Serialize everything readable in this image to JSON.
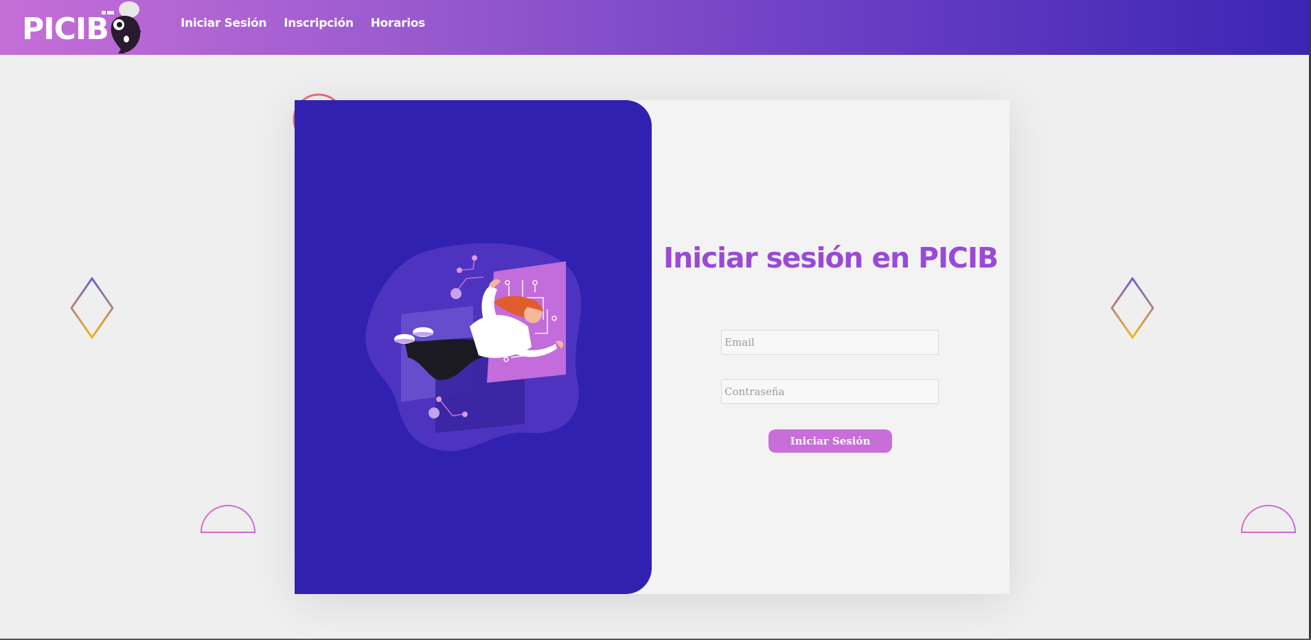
{
  "brand": {
    "logo_text": "PICIB",
    "colors": {
      "nav_start": "#c56ed8",
      "nav_end": "#3b25b3",
      "card_panel": "#3021b0",
      "accent": "#9a4ad6",
      "button": "#c76ed9"
    }
  },
  "nav": {
    "links": [
      {
        "label": "Iniciar Sesión"
      },
      {
        "label": "Inscripción"
      },
      {
        "label": "Horarios"
      }
    ]
  },
  "login": {
    "title": "Iniciar sesión en PICIB",
    "email": {
      "placeholder": "Email",
      "value": ""
    },
    "password": {
      "placeholder": "Contraseña",
      "value": ""
    },
    "submit_label": "Iniciar Sesión"
  },
  "icons": [
    "mascot-icon",
    "diamond-outline-icon",
    "half-circle-outline-icon",
    "circle-outline-icon",
    "floating-person-illustration"
  ]
}
